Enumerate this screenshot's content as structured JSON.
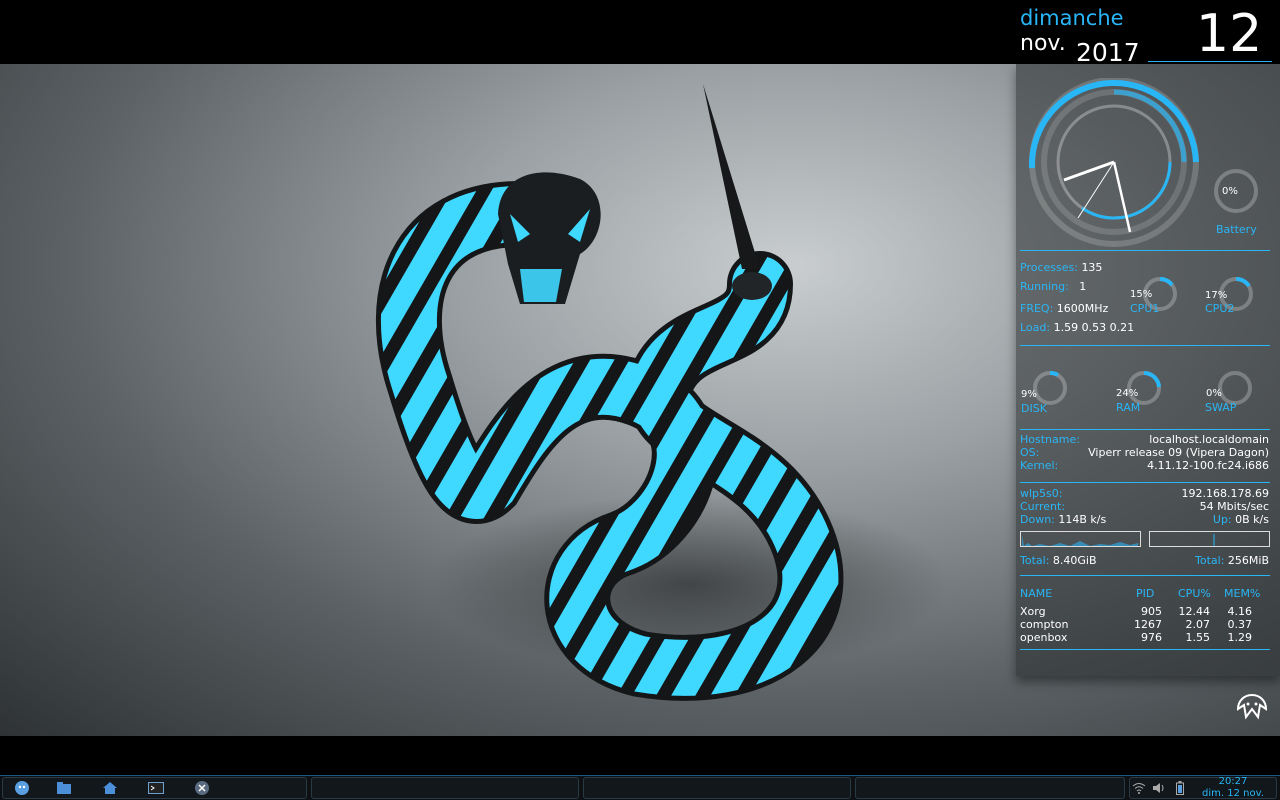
{
  "date": {
    "day_name": "dimanche",
    "month": "nov.",
    "year": "2017",
    "day": "12"
  },
  "battery": {
    "percent": "0%",
    "label": "Battery",
    "level": 0
  },
  "system": {
    "processes_label": "Processes:",
    "processes_value": "135",
    "running_label": "Running:",
    "running_value": "1",
    "freq_label": "FREQ:",
    "freq_value": "1600MHz",
    "load_label": "Load:",
    "load_value": "1.59 0.53 0.21",
    "cpu1": {
      "percent": "15%",
      "label": "CPU1",
      "level": 0.15
    },
    "cpu2": {
      "percent": "17%",
      "label": "CPU2",
      "level": 0.17
    }
  },
  "usage": {
    "disk": {
      "percent": "9%",
      "label": "DISK",
      "level": 0.09
    },
    "ram": {
      "percent": "24%",
      "label": "RAM",
      "level": 0.24
    },
    "swap": {
      "percent": "0%",
      "label": "SWAP",
      "level": 0
    }
  },
  "host": {
    "hostname_label": "Hostname:",
    "hostname_value": "localhost.localdomain",
    "os_label": "OS:",
    "os_value": "Viperr release 09 (Vipera Dagon)",
    "kernel_label": "Kernel:",
    "kernel_value": "4.11.12-100.fc24.i686"
  },
  "network": {
    "iface_label": "wlp5s0:",
    "ip_value": "192.168.178.69",
    "current_label": "Current:",
    "current_value": "54  Mbits/sec",
    "down_label": "Down:",
    "down_value": "114B    k/s",
    "up_label": "Up:",
    "up_value": "0B    k/s",
    "total_down_label": "Total:",
    "total_down_value": "8.40GiB",
    "total_up_label": "Total:",
    "total_up_value": "256MiB"
  },
  "processes_table": {
    "headers": [
      "NAME",
      "PID",
      "CPU%",
      "MEM%"
    ],
    "rows": [
      [
        "Xorg",
        "905",
        "12.44",
        "4.16"
      ],
      [
        "compton",
        "1267",
        "2.07",
        "0.37"
      ],
      [
        "openbox",
        "976",
        "1.55",
        "1.29"
      ]
    ]
  },
  "taskbar": {
    "launchers": [
      "viperr-menu-icon",
      "file-manager-icon",
      "home-icon",
      "terminal-icon",
      "close-session-icon"
    ],
    "tray": [
      "wifi-icon",
      "volume-icon",
      "battery-icon"
    ],
    "clock_time": "20:27",
    "clock_date": "dim. 12 nov."
  },
  "colors": {
    "accent": "#29b6f6",
    "snake_glow": "#3fd8ff"
  }
}
